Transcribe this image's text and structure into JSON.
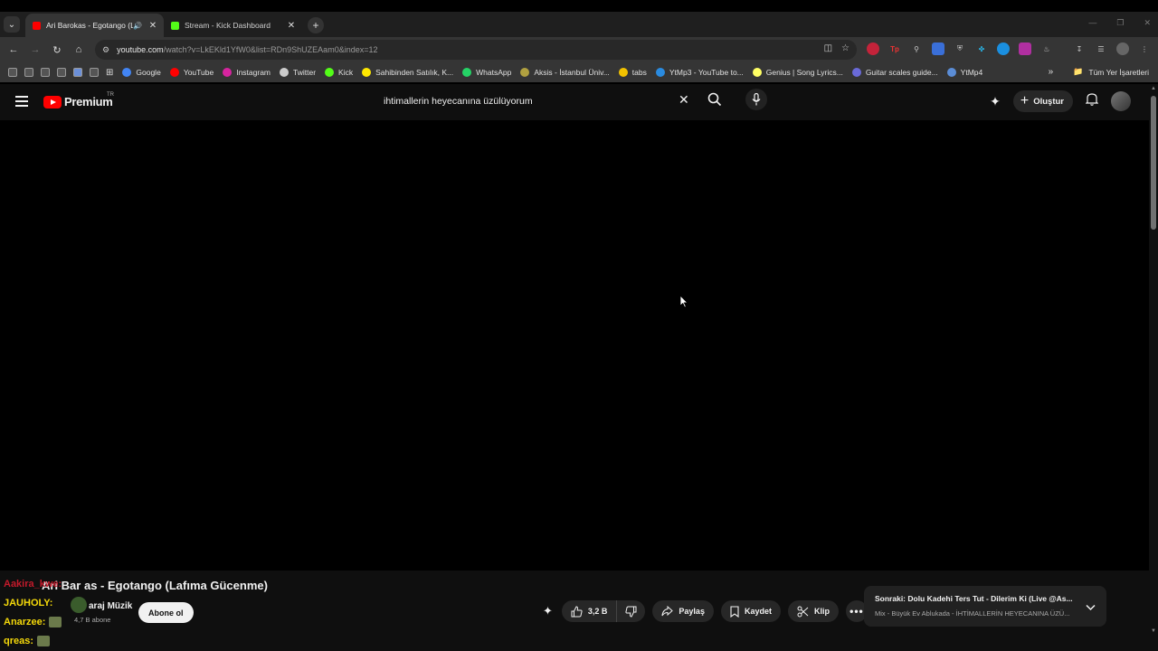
{
  "browser": {
    "tabs": [
      {
        "title": "Ari Barokas - Egotango (Laf",
        "active": true
      },
      {
        "title": "Stream - Kick Dashboard",
        "active": false
      }
    ],
    "url_host": "youtube.com",
    "url_path": "/watch?v=LkEKld1YfW0&list=RDn9ShUZEAam0&index=12",
    "bookmarks": [
      {
        "label": "Google",
        "color": "#4285f4"
      },
      {
        "label": "YouTube",
        "color": "#ff0000"
      },
      {
        "label": "Instagram",
        "color": "#d6249f"
      },
      {
        "label": "Twitter",
        "color": "#cccccc"
      },
      {
        "label": "Kick",
        "color": "#53fc18"
      },
      {
        "label": "Sahibinden Satılık, K...",
        "color": "#ffe800"
      },
      {
        "label": "WhatsApp",
        "color": "#25d366"
      },
      {
        "label": "Aksis - İstanbul Üniv...",
        "color": "#b0a040"
      },
      {
        "label": "tabs",
        "color": "#f2c200"
      },
      {
        "label": "YtMp3 - YouTube to...",
        "color": "#2a8be0"
      },
      {
        "label": "Genius | Song Lyrics...",
        "color": "#ffff64"
      },
      {
        "label": "Guitar scales guide...",
        "color": "#6a6ad8"
      },
      {
        "label": "YtMp4",
        "color": "#5b8dd6"
      }
    ],
    "bookmarks_folder": "Tüm Yer İşaretleri"
  },
  "youtube": {
    "brand": "Premium",
    "region": "TR",
    "search_query": "ihtimallerin heyecanına üzülüyorum",
    "create_label": "Oluştur",
    "video_title": "Ari Bar   as - Egotango (Lafıma Gücenme)",
    "channel_name": "araj Müzik",
    "subscribers": "4,7 B abone",
    "subscribe_label": "Abone ol",
    "like_count": "3,2 B",
    "share_label": "Paylaş",
    "save_label": "Kaydet",
    "clip_label": "Klip",
    "next_title": "Sonraki: Dolu Kadehi Ters Tut - Dilerim Ki (Live @As...",
    "next_sub": "Mix - Büyük Ev Ablukada - İHTİMALLERİN HEYECANINA ÜZÜ..."
  },
  "chat_overlay": [
    {
      "user": "Aakira_kwe:",
      "color": "#c41a2b"
    },
    {
      "user": "JAUHOLY:",
      "color": "#f5d90a"
    },
    {
      "user": "Anarzee:",
      "color": "#f5d90a"
    },
    {
      "user": "qreas:",
      "color": "#f5d90a"
    }
  ]
}
